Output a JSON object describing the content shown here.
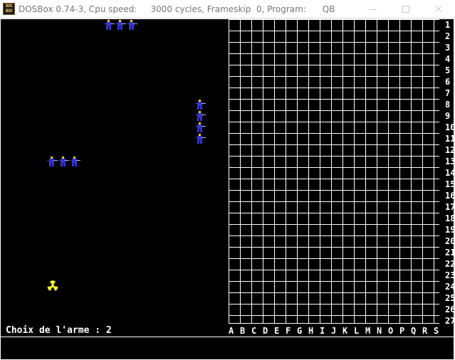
{
  "window": {
    "title": "DOSBox 0.74-3, Cpu speed:     3000 cycles, Frameskip  0, Program:      QB",
    "icon_text_top": "DOS",
    "icon_text_bottom": "BOX"
  },
  "game": {
    "weapon_prompt": "Choix de l'arme : 2",
    "grid": {
      "columns": [
        "A",
        "B",
        "C",
        "D",
        "E",
        "F",
        "G",
        "H",
        "I",
        "J",
        "K",
        "L",
        "M",
        "N",
        "O",
        "P",
        "Q",
        "R",
        "S"
      ],
      "rows": [
        "1",
        "2",
        "3",
        "4",
        "5",
        "6",
        "7",
        "8",
        "9",
        "10",
        "11",
        "12",
        "13",
        "14",
        "15",
        "16",
        "17",
        "18",
        "19",
        "20",
        "21",
        "22",
        "23",
        "24",
        "25",
        "26",
        "27"
      ]
    },
    "colors": {
      "screen_background": "#000000",
      "grid_line": "#ffffff",
      "soldier_body": "#3333cc",
      "soldier_head": "#ffcc33",
      "radiation_symbol": "#ffff33"
    },
    "sprites": {
      "soldier_icon": "soldier-icon",
      "weapon_icon": "radiation-icon"
    }
  }
}
